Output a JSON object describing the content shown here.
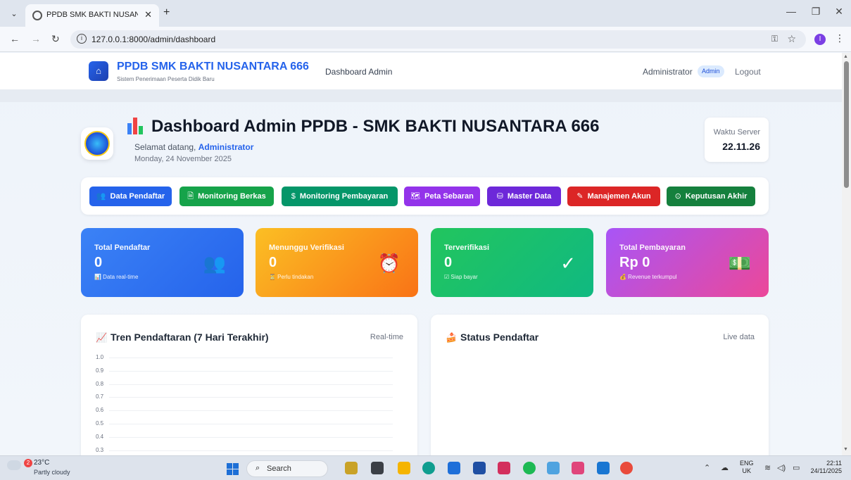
{
  "browser": {
    "tab_title": "PPDB SMK BAKTI NUSANTARA",
    "tab_close": "✕",
    "new_tab": "+",
    "url": "127.0.0.1:8000/admin/dashboard",
    "profile_initial": "I"
  },
  "navbar": {
    "brand": "PPDB SMK BAKTI NUSANTARA 666",
    "subtitle": "Sistem Penerimaan Peserta Didik Baru",
    "link": "Dashboard Admin",
    "user": "Administrator",
    "badge": "Admin",
    "logout": "Logout"
  },
  "header": {
    "title": "Dashboard Admin PPDB - SMK BAKTI NUSANTARA 666",
    "welcome_prefix": "Selamat datang, ",
    "welcome_name": "Administrator",
    "date": "Monday, 24 November 2025",
    "server_label": "Waktu Server",
    "server_time": "22.11.26"
  },
  "quick_actions": [
    {
      "label": "Data Pendaftar",
      "icon": "👥",
      "color": "#2563eb"
    },
    {
      "label": "Monitoring Berkas",
      "icon": "🗎",
      "color": "#16a34a"
    },
    {
      "label": "Monitoring Pembayaran",
      "icon": "$",
      "color": "#059669"
    },
    {
      "label": "Peta Sebaran",
      "icon": "🗺",
      "color": "#9333ea"
    },
    {
      "label": "Master Data",
      "icon": "⛁",
      "color": "#6d28d9"
    },
    {
      "label": "Manajemen Akun",
      "icon": "✎",
      "color": "#dc2626"
    },
    {
      "label": "Keputusan Akhir",
      "icon": "⊙",
      "color": "#15803d"
    }
  ],
  "stats": [
    {
      "label": "Total Pendaftar",
      "value": "0",
      "foot": "📊 Data real-time",
      "icon": "👥"
    },
    {
      "label": "Menunggu Verifikasi",
      "value": "0",
      "foot": "⏳ Perlu tindakan",
      "icon": "⏰"
    },
    {
      "label": "Terverifikasi",
      "value": "0",
      "foot": "☑ Siap bayar",
      "icon": "✓"
    },
    {
      "label": "Total Pembayaran",
      "value": "Rp 0",
      "foot": "💰 Revenue terkumpul",
      "icon": "💵"
    }
  ],
  "panels": {
    "trend": {
      "title": "Tren Pendaftaran (7 Hari Terakhir)",
      "meta": "Real-time",
      "icon": "📈"
    },
    "status": {
      "title": "Status Pendaftar",
      "meta": "Live data",
      "icon": "🍰"
    }
  },
  "chart_data": {
    "type": "line",
    "title": "Tren Pendaftaran (7 Hari Terakhir)",
    "series": [],
    "y_ticks": [
      "1.0",
      "0.9",
      "0.8",
      "0.7",
      "0.6",
      "0.5",
      "0.4",
      "0.3"
    ],
    "ylim": [
      0,
      1.0
    ],
    "grid": true
  },
  "taskbar": {
    "temp": "23°C",
    "weather": "Partly cloudy",
    "weather_badge": "2",
    "search": "Search",
    "lang1": "ENG",
    "lang2": "UK",
    "time": "22:11",
    "date": "24/11/2025"
  }
}
